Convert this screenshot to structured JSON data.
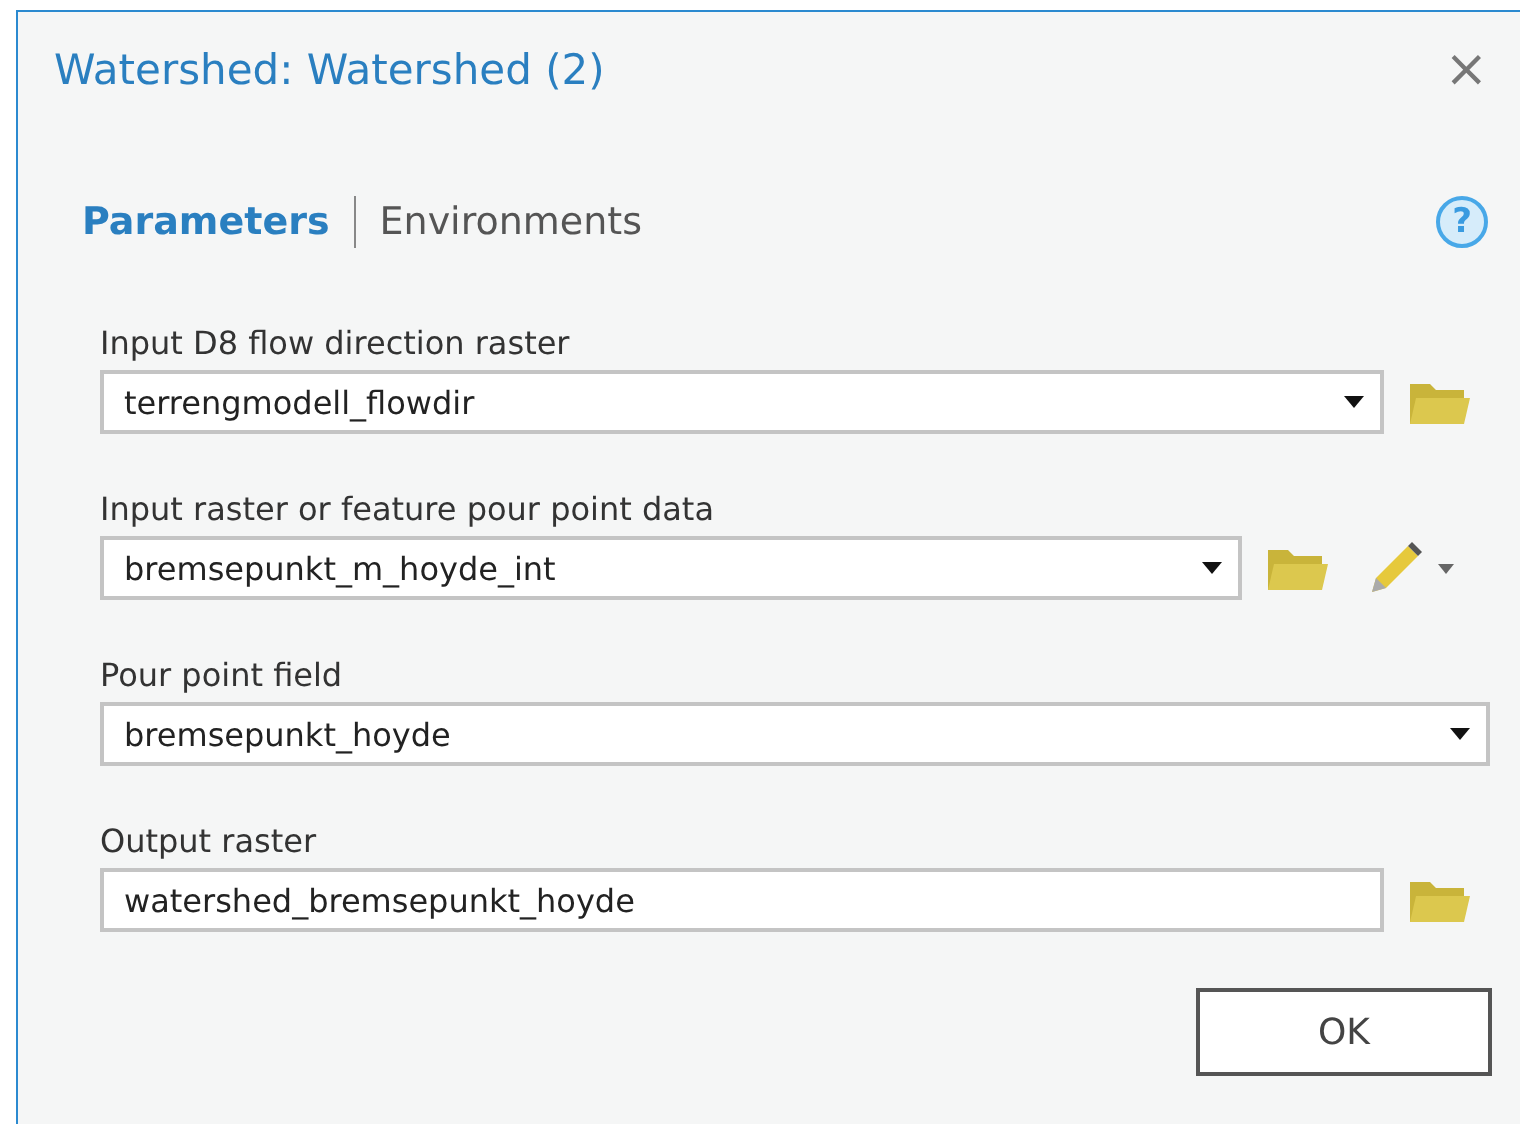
{
  "window": {
    "title": "Watershed: Watershed (2)",
    "close": "×"
  },
  "tabs": [
    {
      "label": "Parameters",
      "selected": true
    },
    {
      "label": "Environments",
      "selected": false
    }
  ],
  "help": "?",
  "parameters": [
    {
      "label": "Input D8 flow direction raster",
      "kind": "dropdown",
      "value": "terrengmodell_flowdir",
      "browse": true,
      "sketch": false
    },
    {
      "label": "Input raster or feature pour point data",
      "kind": "dropdown",
      "value": "bremsepunkt_m_hoyde_int",
      "browse": true,
      "sketch": true
    },
    {
      "label": "Pour point field",
      "kind": "dropdown",
      "value": "bremsepunkt_hoyde",
      "browse": false,
      "sketch": false
    },
    {
      "label": "Output raster",
      "kind": "text",
      "value": "watershed_bremsepunkt_hoyde",
      "browse": true,
      "sketch": false
    }
  ],
  "buttons": [
    "OK"
  ]
}
